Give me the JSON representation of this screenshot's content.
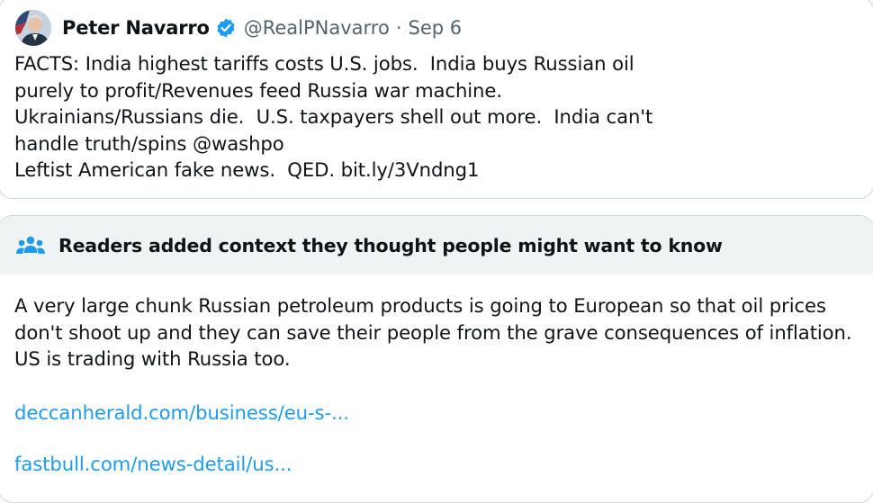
{
  "tweet": {
    "display_name": "Peter Navarro",
    "handle": "@RealPNavarro",
    "separator": "·",
    "date": "Sep 6",
    "avatar_icon": "avatar-photo",
    "verified_icon": "verified-badge-icon",
    "verified_color": "#1d9bf0",
    "text": "FACTS: India highest tariffs costs U.S. jobs.  India buys Russian oil\npurely to profit/Revenues feed Russia war machine.\nUkrainians/Russians die.  U.S. taxpayers shell out more.  India can't\nhandle truth/spins @washpo\nLeftist American fake news.  QED. bit.ly/3Vndng1"
  },
  "community_note": {
    "icon": "people-icon",
    "title": "Readers added context they thought people might want to know",
    "text": "A very large chunk Russian petroleum products is going to European so that oil prices don't shoot up and they can save their people from the grave consequences of inflation. US is trading with Russia too.",
    "links": [
      "deccanherald.com/business/eu-s-...",
      "fastbull.com/news-detail/us..."
    ],
    "header_bg": "#eff3f4",
    "link_color": "#1d9bf0"
  }
}
